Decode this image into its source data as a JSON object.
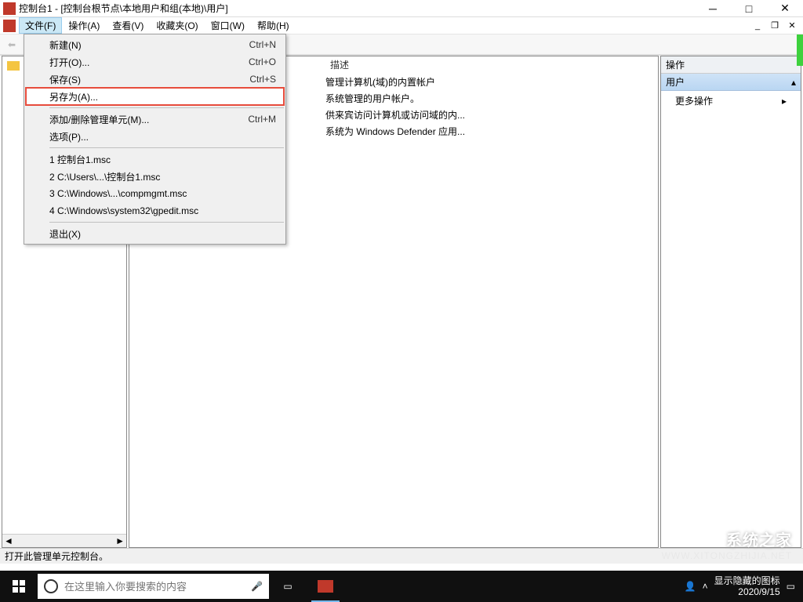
{
  "window": {
    "title": "控制台1 - [控制台根节点\\本地用户和组(本地)\\用户]"
  },
  "menubar": {
    "items": [
      "文件(F)",
      "操作(A)",
      "查看(V)",
      "收藏夹(O)",
      "窗口(W)",
      "帮助(H)"
    ]
  },
  "file_menu": {
    "new": {
      "label": "新建(N)",
      "shortcut": "Ctrl+N"
    },
    "open": {
      "label": "打开(O)...",
      "shortcut": "Ctrl+O"
    },
    "save": {
      "label": "保存(S)",
      "shortcut": "Ctrl+S"
    },
    "saveas": {
      "label": "另存为(A)..."
    },
    "snapin": {
      "label": "添加/删除管理单元(M)...",
      "shortcut": "Ctrl+M"
    },
    "options": {
      "label": "选项(P)..."
    },
    "recent": [
      "1 控制台1.msc",
      "2 C:\\Users\\...\\控制台1.msc",
      "3 C:\\Windows\\...\\compmgmt.msc",
      "4 C:\\Windows\\system32\\gpedit.msc"
    ],
    "exit": {
      "label": "退出(X)"
    }
  },
  "list": {
    "desc_header": "描述",
    "rows": [
      "管理计算机(域)的内置帐户",
      "系统管理的用户帐户。",
      "供来宾访问计算机或访问域的内...",
      "系统为 Windows Defender 应用..."
    ]
  },
  "right": {
    "panel_title": "操作",
    "section_title": "用户",
    "more_actions": "更多操作"
  },
  "status": {
    "text": "打开此管理单元控制台。"
  },
  "taskbar": {
    "search_placeholder": "在这里输入你要搜索的内容",
    "tray_text": "显示隐藏的图标",
    "date": "2020/9/15"
  },
  "watermark": {
    "brand": "系统之家",
    "url": "WWW.XITONGZHIJIA.NET"
  }
}
